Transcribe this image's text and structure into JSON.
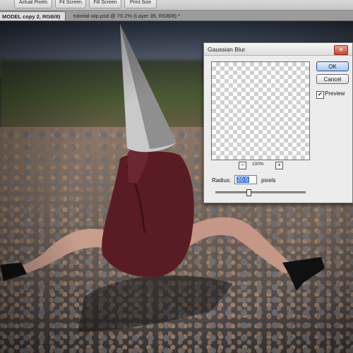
{
  "options_bar": {
    "buttons": [
      {
        "label": "Actual Pixels"
      },
      {
        "label": "Fit Screen"
      },
      {
        "label": "Fill Screen"
      },
      {
        "label": "Print Size"
      }
    ]
  },
  "tabs": [
    {
      "label": "MODEL copy 2, RGB/8) *",
      "active": true
    },
    {
      "label": "tutorial wip.psd @ 70.2% (Layer 35, RGB/8) *",
      "active": false
    }
  ],
  "dialog": {
    "title": "Gaussian Blur",
    "ok_label": "OK",
    "cancel_label": "Cancel",
    "preview_label": "Preview",
    "preview_checked": true,
    "zoom_out": "−",
    "zoom_in": "+",
    "zoom_level": "100%",
    "radius_label": "Radius:",
    "radius_value": "20.5",
    "unit": "pixels",
    "slider_fraction": 0.37
  },
  "colors": {
    "ok_button": "#a9c6ef",
    "close_button": "#c6452a",
    "selection": "#3d78d8"
  }
}
